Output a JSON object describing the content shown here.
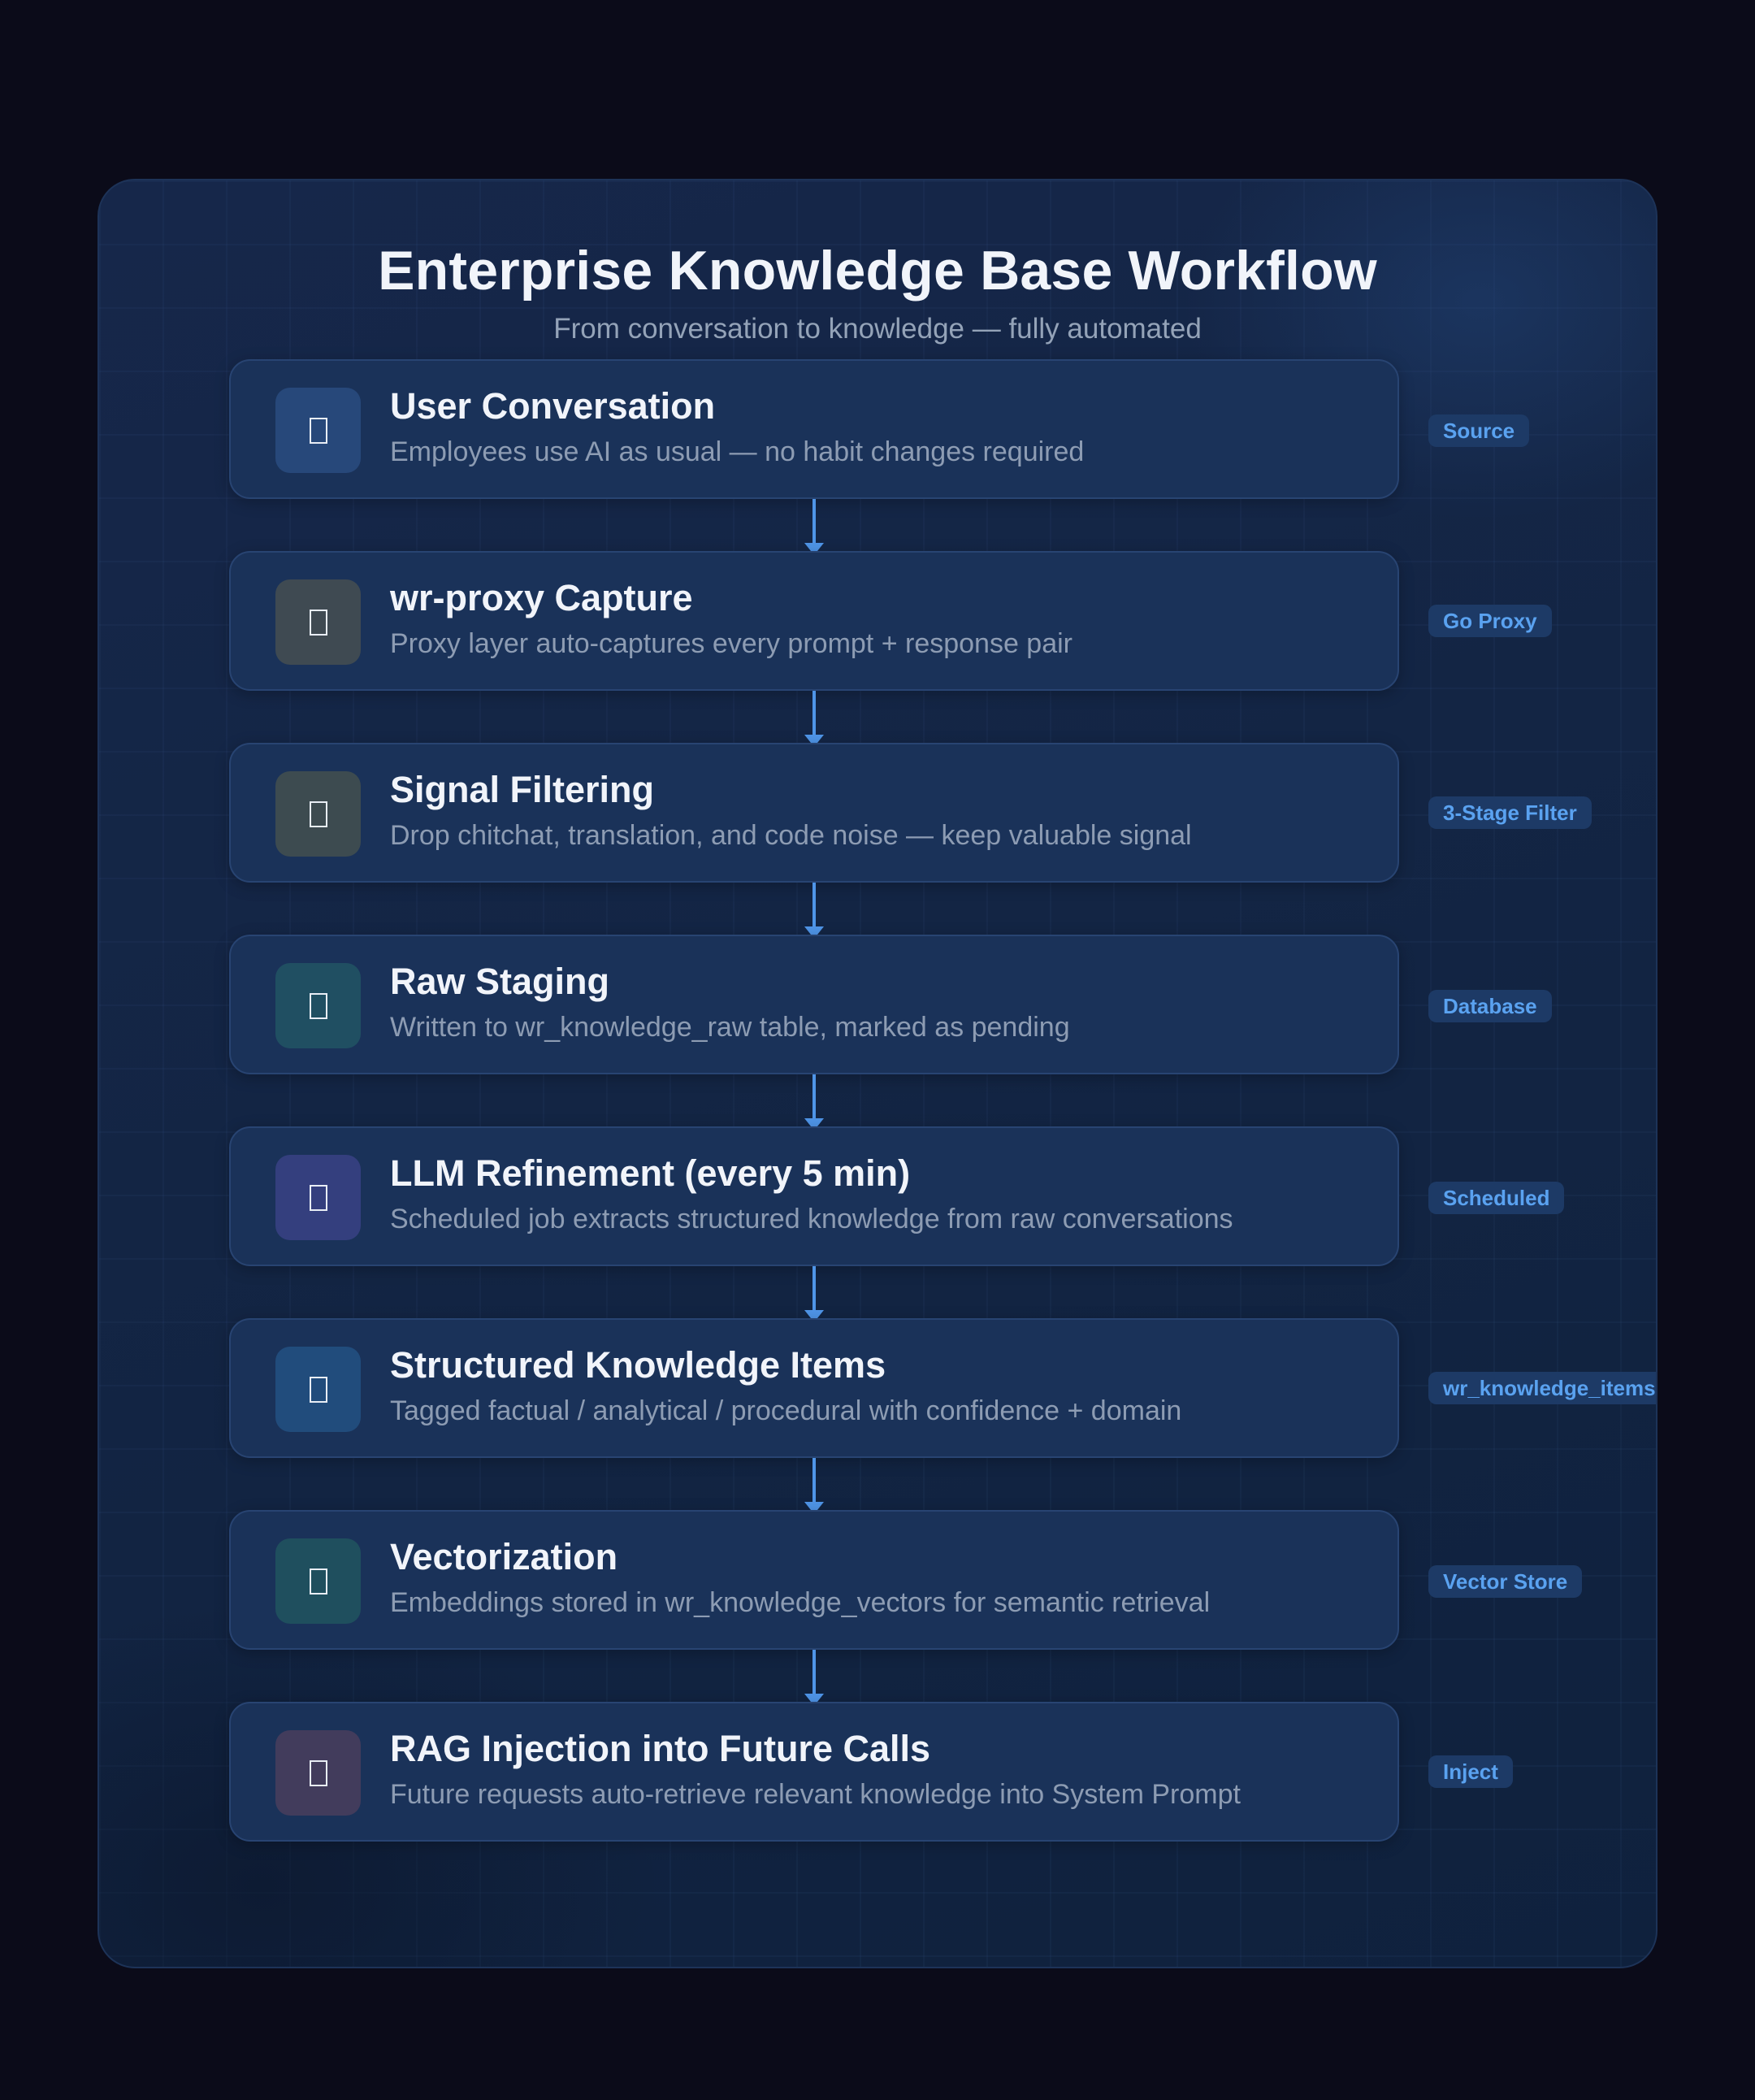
{
  "header": {
    "title": "Enterprise Knowledge Base Workflow",
    "subtitle": "From conversation to knowledge — fully automated"
  },
  "steps": [
    {
      "title": "User Conversation",
      "description": "Employees use AI as usual — no habit changes required",
      "tag": "Source",
      "icon": "chat-icon",
      "icon_color": "#27487a"
    },
    {
      "title": "wr-proxy Capture",
      "description": "Proxy layer auto-captures every prompt + response pair",
      "tag": "Go Proxy",
      "icon": "capture-icon",
      "icon_color": "#3f4a52"
    },
    {
      "title": "Signal Filtering",
      "description": "Drop chitchat, translation, and code noise — keep valuable signal",
      "tag": "3-Stage Filter",
      "icon": "filter-icon",
      "icon_color": "#3d4b50"
    },
    {
      "title": "Raw Staging",
      "description": "Written to wr_knowledge_raw table, marked as pending",
      "tag": "Database",
      "icon": "database-icon",
      "icon_color": "#204f62"
    },
    {
      "title": "LLM Refinement (every 5 min)",
      "description": "Scheduled job extracts structured knowledge from raw conversations",
      "tag": "Scheduled",
      "icon": "robot-icon",
      "icon_color": "#343f7e"
    },
    {
      "title": "Structured Knowledge Items",
      "description": "Tagged factual / analytical / procedural with confidence + domain",
      "tag": "wr_knowledge_items",
      "icon": "tag-icon",
      "icon_color": "#214c7c"
    },
    {
      "title": "Vectorization",
      "description": "Embeddings stored in wr_knowledge_vectors for semantic retrieval",
      "tag": "Vector Store",
      "icon": "vector-icon",
      "icon_color": "#1f4f5e"
    },
    {
      "title": "RAG Injection into Future Calls",
      "description": "Future requests auto-retrieve relevant knowledge into System Prompt",
      "tag": "Inject",
      "icon": "inject-icon",
      "icon_color": "#423c5c"
    }
  ]
}
